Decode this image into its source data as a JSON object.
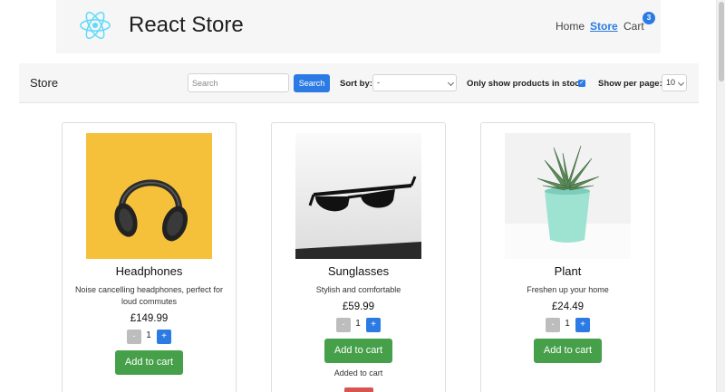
{
  "navbar": {
    "brand": "React Store",
    "links": {
      "home": "Home",
      "store": "Store",
      "cart": "Cart"
    },
    "cart_count": "3",
    "logo_icon": "react-atom-icon",
    "accent_color": "#2c7be5",
    "logo_color": "#61dafb"
  },
  "toolbar": {
    "title": "Store",
    "search_placeholder": "Search",
    "search_button": "Search",
    "sort_label": "Sort by:",
    "sort_value": "-",
    "stock_label": "Only show products in stock",
    "stock_checked": true,
    "perpage_label": "Show per page:",
    "perpage_value": "10"
  },
  "products": [
    {
      "name": "Headphones",
      "description": "Noise cancelling headphones, perfect for loud commutes",
      "price": "£149.99",
      "quantity": "1",
      "add_label": "Add to cart",
      "image_icon": "headphones-image",
      "image_bg": "#f5c13a"
    },
    {
      "name": "Sunglasses",
      "description": "Stylish and comfortable",
      "price": "£59.99",
      "quantity": "1",
      "add_label": "Add to cart",
      "added_text": "Added to cart",
      "image_icon": "sunglasses-image",
      "image_bg": "#e9e9e9"
    },
    {
      "name": "Plant",
      "description": "Freshen up your home",
      "price": "£24.49",
      "quantity": "1",
      "add_label": "Add to cart",
      "image_icon": "plant-image",
      "image_bg": "#f2f2f2"
    }
  ],
  "qty_controls": {
    "minus": "-",
    "plus": "+"
  },
  "colors": {
    "add_button": "#46a049",
    "remove_button": "#d9534f",
    "minus_button": "#bdbdbd"
  }
}
